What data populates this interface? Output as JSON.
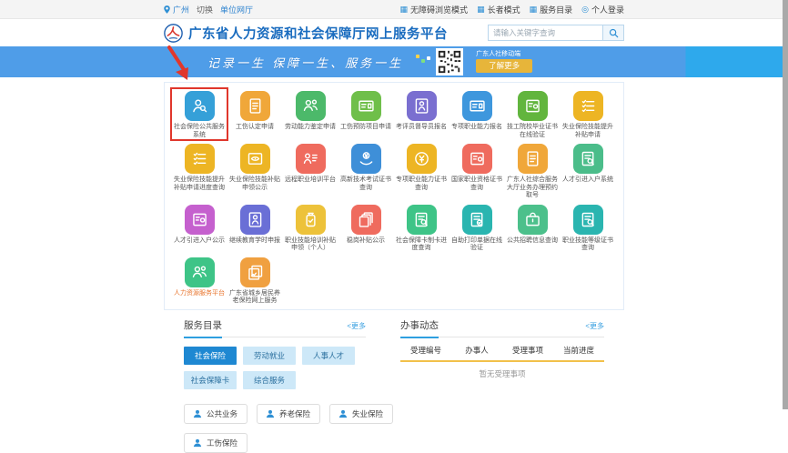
{
  "topbar": {
    "city": "广州",
    "switch_label": "切换",
    "unit_hall": "单位网厅",
    "accessibility_mode": "无障碍浏览模式",
    "elder_mode": "长者模式",
    "service_catalog": "服务目录",
    "personal_login": "个人登录"
  },
  "header": {
    "title": "广东省人力资源和社会保障厅网上服务平台",
    "search_placeholder": "请输入关键字查询"
  },
  "banner": {
    "slogan": "记录一生 保障一生、服务一生",
    "qr_label": "广东人社移动端",
    "more_button": "了解更多",
    "bg_left": "#4f9de8",
    "bg_right": "#2ea9ec",
    "button_color": "#e7b53a"
  },
  "grid": {
    "items": [
      {
        "label": "社会保险公共服务系统",
        "color": "#35a0d8",
        "icon": "person-search",
        "highlighted": true
      },
      {
        "label": "工伤认定申请",
        "color": "#f0a73a",
        "icon": "doc"
      },
      {
        "label": "劳动能力鉴定申请",
        "color": "#4cb96a",
        "icon": "people"
      },
      {
        "label": "工伤预防项目申请",
        "color": "#6fbf4a",
        "icon": "card"
      },
      {
        "label": "考评员督导员报名",
        "color": "#7a6fd0",
        "icon": "person-door"
      },
      {
        "label": "专项职业能力报名",
        "color": "#3e97dd",
        "icon": "card"
      },
      {
        "label": "技工院校毕业证书在线验证",
        "color": "#62b53e",
        "icon": "cert"
      },
      {
        "label": "失业保险技能提升补贴申请",
        "color": "#edb524",
        "icon": "checklist"
      },
      {
        "label": "失业保险技能提升补贴申请进度查询",
        "color": "#edb524",
        "icon": "checklist"
      },
      {
        "label": "失业保险技能补贴申领公示",
        "color": "#edb524",
        "icon": "doc-eye"
      },
      {
        "label": "远程职业培训平台",
        "color": "#ef6b5e",
        "icon": "person-list"
      },
      {
        "label": "高新技术考试证书查询",
        "color": "#3e8fd8",
        "icon": "hand-coin"
      },
      {
        "label": "专项职业能力证书查询",
        "color": "#edb524",
        "icon": "coin"
      },
      {
        "label": "国家职业资格证书查询",
        "color": "#ef6b5e",
        "icon": "cert"
      },
      {
        "label": "广东人社综合服务大厅业务办理预约取号",
        "color": "#f0a73a",
        "icon": "doc"
      },
      {
        "label": "人才引进入户系统",
        "color": "#4bbd8a",
        "icon": "doc-search"
      },
      {
        "label": "人才引进入户公示",
        "color": "#c560ce",
        "icon": "cert"
      },
      {
        "label": "继续教育学时申报",
        "color": "#6a6fd6",
        "icon": "person-door"
      },
      {
        "label": "职业技能培训补贴申领（个人）",
        "color": "#edc23a",
        "icon": "jar"
      },
      {
        "label": "稳岗补贴公示",
        "color": "#ef6b5e",
        "icon": "docs"
      },
      {
        "label": "社会保障卡制卡进度查询",
        "color": "#3ec487",
        "icon": "doc-search"
      },
      {
        "label": "自助打印单据在线验证",
        "color": "#2ab5b0",
        "icon": "doc-check"
      },
      {
        "label": "公共招聘信息查询",
        "color": "#4cc08b",
        "icon": "bag"
      },
      {
        "label": "职业技能等级证书查询",
        "color": "#2ab5b0",
        "icon": "doc-search"
      },
      {
        "label": "人力资源服务平台",
        "color": "#3ec487",
        "icon": "people",
        "label_color": "#e8742c"
      },
      {
        "label": "广东省城乡居民养老保险网上服务",
        "color": "#f0a040",
        "icon": "photo-check"
      }
    ]
  },
  "service_catalog": {
    "title": "服务目录",
    "more": "<更多",
    "tabs": [
      {
        "label": "社会保险",
        "active": true
      },
      {
        "label": "劳动就业",
        "active": false
      },
      {
        "label": "人事人才",
        "active": false
      },
      {
        "label": "社会保障卡",
        "active": false
      },
      {
        "label": "综合服务",
        "active": false
      }
    ],
    "buttons": [
      "公共业务",
      "养老保险",
      "失业保险",
      "工伤保险"
    ],
    "active_tab_color": "#1e88d2"
  },
  "progress": {
    "title": "办事动态",
    "more": "<更多",
    "columns": [
      "受理编号",
      "办事人",
      "受理事项",
      "当前进度"
    ],
    "empty_text": "暂无受理事项",
    "underline_color": "#f2c14a"
  }
}
